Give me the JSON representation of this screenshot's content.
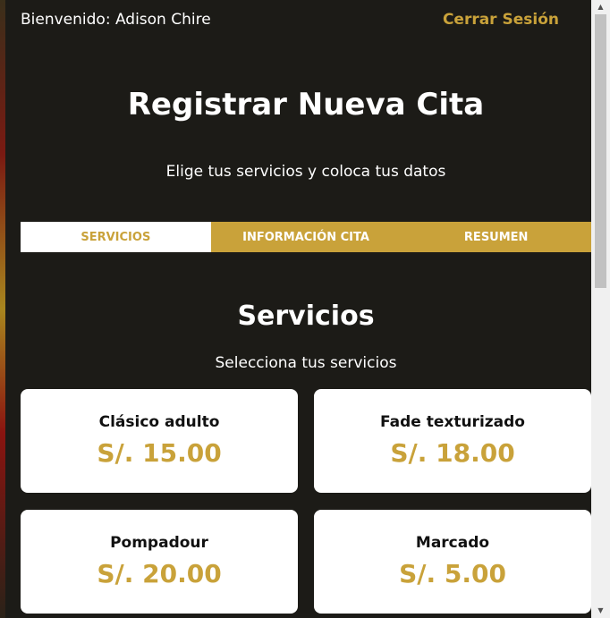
{
  "header": {
    "welcome": "Bienvenido: Adison Chire",
    "logout": "Cerrar Sesión"
  },
  "page": {
    "title": "Registrar Nueva Cita",
    "subtitle": "Elige tus servicios y coloca tus datos"
  },
  "tabs": [
    {
      "label": "Servicios",
      "active": true
    },
    {
      "label": "Información Cita",
      "active": false
    },
    {
      "label": "Resumen",
      "active": false
    }
  ],
  "services_section": {
    "title": "Servicios",
    "subtitle": "Selecciona tus servicios"
  },
  "services": [
    {
      "name": "Clásico adulto",
      "price": "S/. 15.00"
    },
    {
      "name": "Fade texturizado",
      "price": "S/. 18.00"
    },
    {
      "name": "Pompadour",
      "price": "S/. 20.00"
    },
    {
      "name": "Marcado",
      "price": "S/. 5.00"
    }
  ],
  "colors": {
    "background": "#1c1b17",
    "accent": "#c9a23a",
    "card": "#ffffff"
  },
  "icons": {
    "scroll_up": "triangle-up-icon",
    "scroll_down": "triangle-down-icon"
  }
}
